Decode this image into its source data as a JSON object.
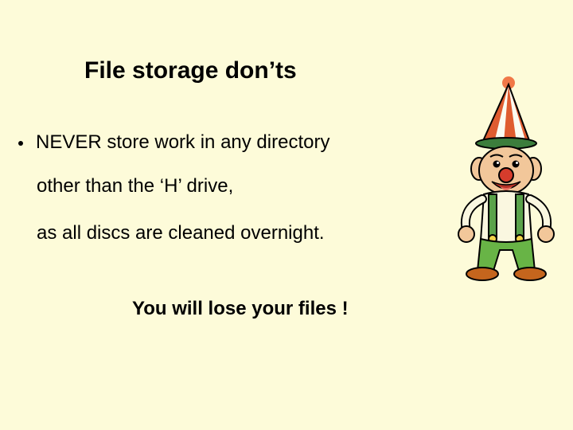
{
  "slide": {
    "title": "File storage don’ts",
    "bullet_line1": "NEVER store work in any directory",
    "bullet_line2": "other than the ‘H’ drive,",
    "bullet_line3": "as all discs are cleaned overnight.",
    "warning": "You will lose your files !"
  }
}
